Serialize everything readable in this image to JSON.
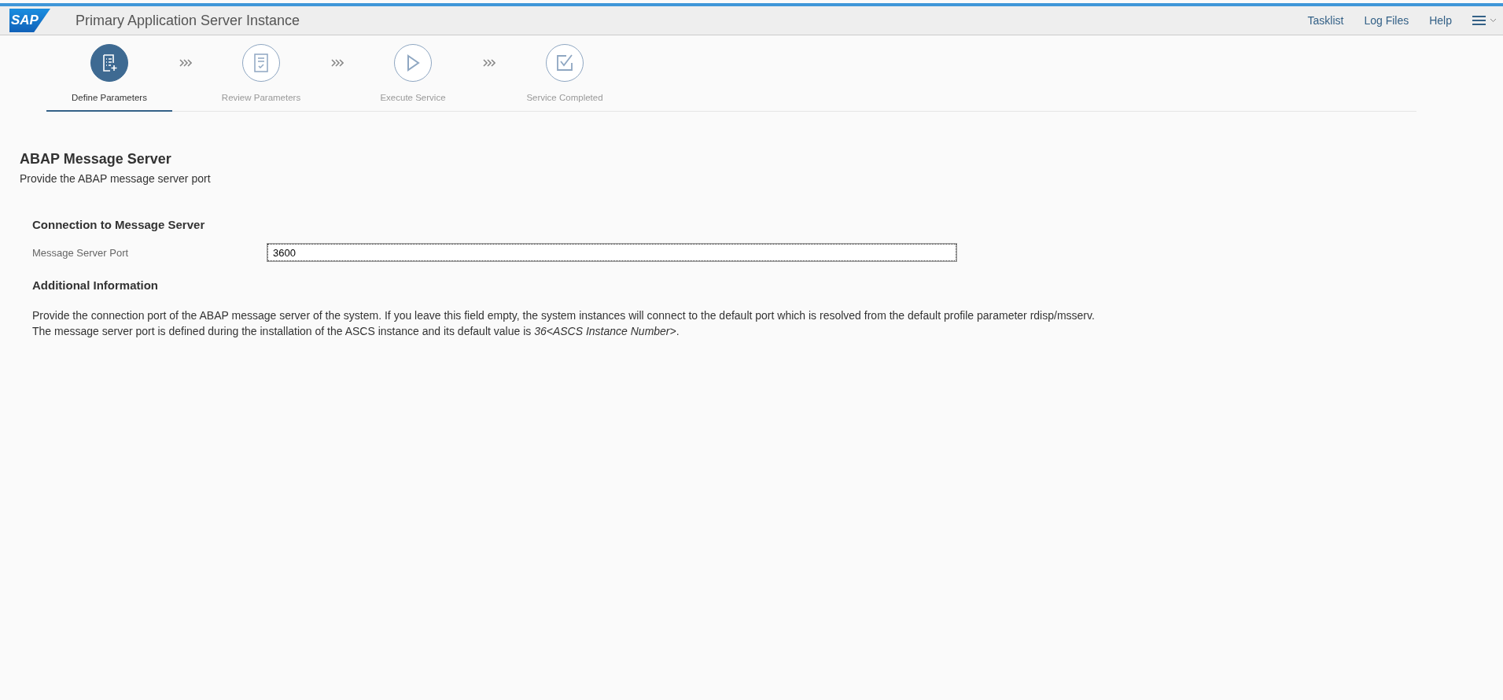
{
  "header": {
    "logo": "SAP",
    "title": "Primary Application Server Instance",
    "links": [
      "Tasklist",
      "Log Files",
      "Help"
    ]
  },
  "steps": [
    {
      "kind": "define",
      "label": "Define Parameters",
      "selected": true
    },
    {
      "kind": "review",
      "label": "Review Parameters",
      "selected": false
    },
    {
      "kind": "execute",
      "label": "Execute Service",
      "selected": false
    },
    {
      "kind": "completed",
      "label": "Service Completed",
      "selected": false
    }
  ],
  "page": {
    "title": "ABAP Message Server",
    "subtitle": "Provide the ABAP message server port"
  },
  "section": {
    "title": "Connection to Message Server",
    "fields": [
      {
        "label": "Message Server Port",
        "value": "3600"
      }
    ]
  },
  "info": {
    "title": "Additional Information",
    "lines": [
      "Provide the connection port of the ABAP message server of the system. If you leave this field empty, the system instances will connect to the default port which is resolved from the default profile parameter rdisp/msserv.",
      "The message server port is defined during the installation of the ASCS instance and its default value is *36<ASCS Instance Number>*."
    ]
  }
}
